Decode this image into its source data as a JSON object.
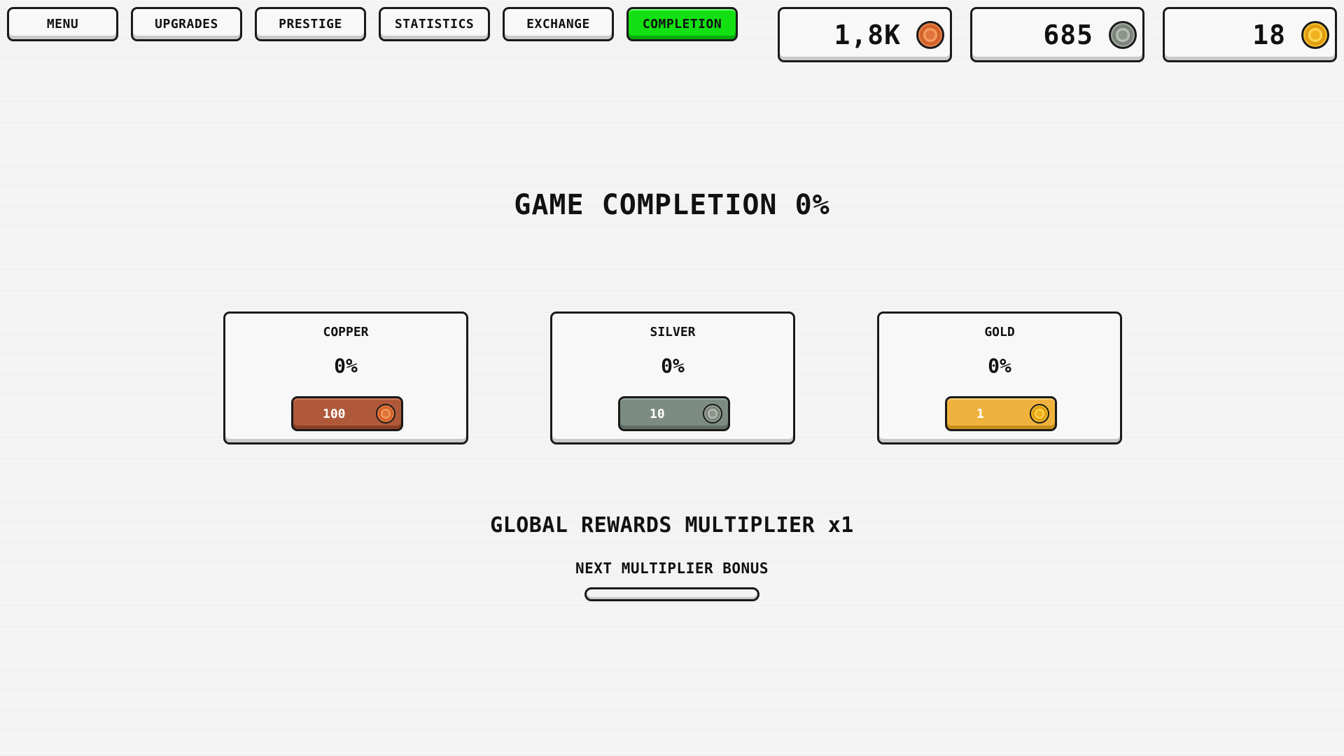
{
  "nav": {
    "items": [
      {
        "id": "menu",
        "label": "MENU"
      },
      {
        "id": "upgrades",
        "label": "UPGRADES"
      },
      {
        "id": "prestige",
        "label": "PRESTIGE"
      },
      {
        "id": "statistics",
        "label": "STATISTICS"
      },
      {
        "id": "exchange",
        "label": "EXCHANGE"
      },
      {
        "id": "completion",
        "label": "COMPLETION"
      }
    ],
    "active": "completion"
  },
  "currencies": [
    {
      "name": "copper",
      "value": "1,8K",
      "icon": "copper-coin-icon"
    },
    {
      "name": "silver",
      "value": "685",
      "icon": "silver-coin-icon"
    },
    {
      "name": "gold",
      "value": "18",
      "icon": "gold-coin-icon"
    }
  ],
  "completion": {
    "title": "GAME COMPLETION 0%",
    "cards": [
      {
        "label": "COPPER",
        "percent": "0%",
        "cost": "100",
        "icon": "copper-coin-icon"
      },
      {
        "label": "SILVER",
        "percent": "0%",
        "cost": "10",
        "icon": "silver-coin-icon"
      },
      {
        "label": "GOLD",
        "percent": "0%",
        "cost": "1",
        "icon": "gold-coin-icon"
      }
    ]
  },
  "multiplier": {
    "title": "GLOBAL REWARDS MULTIPLIER x1",
    "next_label": "NEXT MULTIPLIER BONUS",
    "progress": 0
  },
  "colors": {
    "active_tab": "#12e012",
    "copper": "#b0593a",
    "silver": "#7c8c82",
    "gold": "#f0b23e"
  }
}
